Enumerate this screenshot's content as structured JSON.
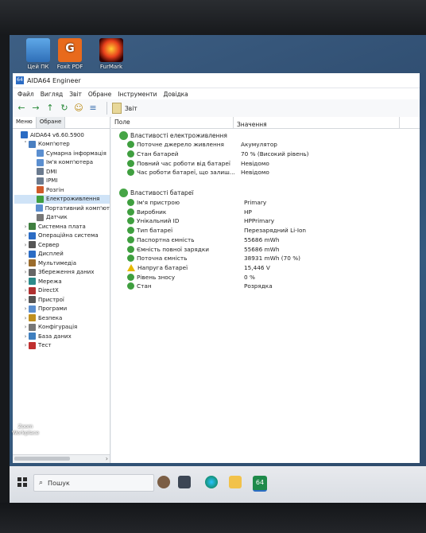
{
  "desktop": {
    "icons": [
      {
        "label": "Цей ПК"
      },
      {
        "label": "Foxit PDF"
      },
      {
        "label": "FurMark"
      }
    ],
    "zoom_label": "Zoom Workplace"
  },
  "window": {
    "title": "AIDA64 Engineer",
    "menu": [
      "Файл",
      "Вигляд",
      "Звіт",
      "Обране",
      "Інструменти",
      "Довідка"
    ],
    "toolbar_report": "Звіт"
  },
  "left_pane": {
    "tabs": [
      "Меню",
      "Обране"
    ],
    "tree": [
      {
        "label": "AIDA64 v6.60.5900",
        "level": 0,
        "expander": "",
        "color": "#2b6cc4"
      },
      {
        "label": "Комп'ютер",
        "level": 1,
        "expander": "v",
        "color": "#4a7fc1"
      },
      {
        "label": "Сумарна інформація",
        "level": 2,
        "expander": "",
        "color": "#5b8fd0"
      },
      {
        "label": "Ім'я комп'ютера",
        "level": 2,
        "expander": "",
        "color": "#5b8fd0"
      },
      {
        "label": "DMI",
        "level": 2,
        "expander": "",
        "color": "#6b7b8f"
      },
      {
        "label": "IPMI",
        "level": 2,
        "expander": "",
        "color": "#6b7b8f"
      },
      {
        "label": "Розгін",
        "level": 2,
        "expander": "",
        "color": "#d05a2a"
      },
      {
        "label": "Електроживлення",
        "level": 2,
        "expander": "",
        "color": "#3f9f3f",
        "selected": true
      },
      {
        "label": "Портативний комп'ют",
        "level": 2,
        "expander": "",
        "color": "#5b8fd0"
      },
      {
        "label": "Датчик",
        "level": 2,
        "expander": "",
        "color": "#777"
      },
      {
        "label": "Системна плата",
        "level": 1,
        "expander": ">",
        "color": "#3f7f3f"
      },
      {
        "label": "Операційна система",
        "level": 1,
        "expander": ">",
        "color": "#2b6cc4"
      },
      {
        "label": "Сервер",
        "level": 1,
        "expander": ">",
        "color": "#555"
      },
      {
        "label": "Дисплей",
        "level": 1,
        "expander": ">",
        "color": "#2b6cc4"
      },
      {
        "label": "Мультимедіа",
        "level": 1,
        "expander": ">",
        "color": "#9a6b2b"
      },
      {
        "label": "Збереження даних",
        "level": 1,
        "expander": ">",
        "color": "#666"
      },
      {
        "label": "Мережа",
        "level": 1,
        "expander": ">",
        "color": "#2b8a8a"
      },
      {
        "label": "DirectX",
        "level": 1,
        "expander": ">",
        "color": "#b03030"
      },
      {
        "label": "Пристрої",
        "level": 1,
        "expander": ">",
        "color": "#555"
      },
      {
        "label": "Програми",
        "level": 1,
        "expander": ">",
        "color": "#5b8fd0"
      },
      {
        "label": "Безпека",
        "level": 1,
        "expander": ">",
        "color": "#c09020"
      },
      {
        "label": "Конфігурація",
        "level": 1,
        "expander": ">",
        "color": "#777"
      },
      {
        "label": "База даних",
        "level": 1,
        "expander": ">",
        "color": "#3f7fbf"
      },
      {
        "label": "Тест",
        "level": 1,
        "expander": ">",
        "color": "#c03030"
      }
    ]
  },
  "right_pane": {
    "columns": [
      "Поле",
      "Значення"
    ],
    "groups": [
      {
        "title": "Властивості електроживлення",
        "rows": [
          {
            "field": "Поточне джерело живлення",
            "value": "Акумулятор",
            "icon": "green"
          },
          {
            "field": "Стан батарей",
            "value": "70 % (Високий рівень)",
            "icon": "green"
          },
          {
            "field": "Повний час роботи від батареї",
            "value": "Невідомо",
            "icon": "green"
          },
          {
            "field": "Час роботи батареї, що залиш...",
            "value": "Невідомо",
            "icon": "green"
          }
        ]
      },
      {
        "title": "Властивості батареї",
        "rows": [
          {
            "field": "Ім'я пристрою",
            "value": "Primary",
            "icon": "green"
          },
          {
            "field": "Виробник",
            "value": "HP",
            "icon": "green"
          },
          {
            "field": "Унікальний ID",
            "value": "HPPrimary",
            "icon": "green"
          },
          {
            "field": "Тип батареї",
            "value": "Перезарядний Li-Ion",
            "icon": "green"
          },
          {
            "field": "Паспортна ємність",
            "value": "55686 mWh",
            "icon": "green"
          },
          {
            "field": "Ємність повної зарядки",
            "value": "55686 mWh",
            "icon": "green"
          },
          {
            "field": "Поточна ємність",
            "value": "38931 mWh  (70 %)",
            "icon": "green"
          },
          {
            "field": "Напруга батареї",
            "value": "15,446 V",
            "icon": "warn"
          },
          {
            "field": "Рівень зносу",
            "value": "0 %",
            "icon": "green"
          },
          {
            "field": "Стан",
            "value": "Розрядка",
            "icon": "green"
          }
        ]
      }
    ]
  },
  "taskbar": {
    "search_placeholder": "Пошук",
    "aida_badge": "64"
  }
}
